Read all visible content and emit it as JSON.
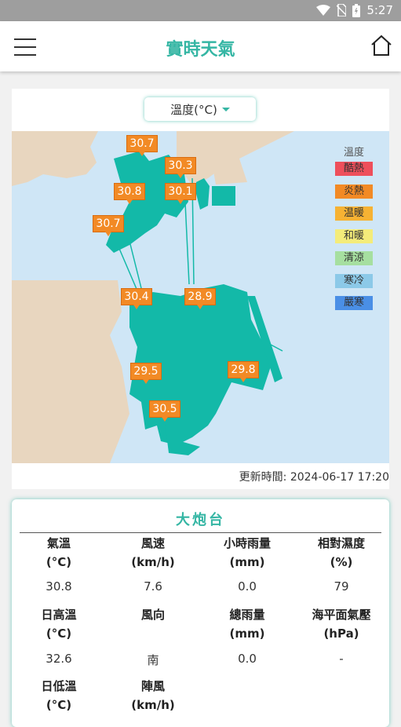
{
  "status_bar": {
    "time": "5:27"
  },
  "header": {
    "title": "實時天氣",
    "menu_icon": "hamburger-icon",
    "home_icon": "home-icon"
  },
  "selector": {
    "label": "溫度(°C)"
  },
  "map": {
    "markers": [
      "30.7",
      "30.3",
      "30.8",
      "30.1",
      "30.7",
      "30.4",
      "28.9",
      "29.5",
      "29.8",
      "30.5"
    ],
    "legend": {
      "title": "溫度",
      "items": [
        {
          "label": "酷熱",
          "color": "#ee4f5b"
        },
        {
          "label": "炎熱",
          "color": "#f28a25"
        },
        {
          "label": "温暖",
          "color": "#f6b233"
        },
        {
          "label": "和暖",
          "color": "#f4ec7a"
        },
        {
          "label": "清涼",
          "color": "#a6dfa0"
        },
        {
          "label": "寒冷",
          "color": "#8cc9e8"
        },
        {
          "label": "嚴寒",
          "color": "#4a8fe6"
        }
      ]
    },
    "colors": {
      "land": "#e8d6bf",
      "water": "#cfe6f6",
      "macau": "#13b9a8"
    }
  },
  "updated": "更新時間: 2024-06-17 17:20",
  "station": {
    "name": "大炮台",
    "rows": [
      {
        "headers": [
          [
            "氣溫",
            "(°C)"
          ],
          [
            "風速",
            "(km/h)"
          ],
          [
            "小時雨量",
            "(mm)"
          ],
          [
            "相對濕度",
            "(%)"
          ]
        ],
        "values": [
          "30.8",
          "7.6",
          "0.0",
          "79"
        ]
      },
      {
        "headers": [
          [
            "日高溫",
            "(°C)"
          ],
          [
            "風向",
            ""
          ],
          [
            "總雨量",
            "(mm)"
          ],
          [
            "海平面氣壓",
            "(hPa)"
          ]
        ],
        "values": [
          "32.6",
          "南",
          "0.0",
          "-"
        ]
      },
      {
        "headers": [
          [
            "日低溫",
            "(°C)"
          ],
          [
            "陣風",
            "(km/h)"
          ]
        ],
        "values": []
      }
    ]
  }
}
